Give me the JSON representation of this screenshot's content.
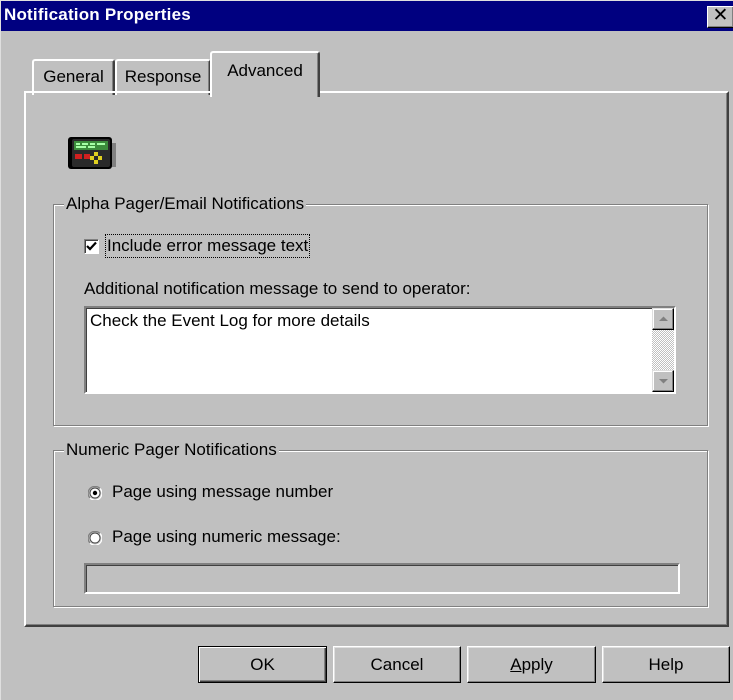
{
  "window": {
    "title": "Notification Properties",
    "close_glyph": "✕"
  },
  "tabs": [
    {
      "label": "General",
      "selected": false
    },
    {
      "label": "Response",
      "selected": false
    },
    {
      "label": "Advanced",
      "selected": true
    }
  ],
  "icon": {
    "name": "pager-icon"
  },
  "alpha_group": {
    "title": "Alpha Pager/Email Notifications",
    "include_error": {
      "label": "Include error message text",
      "checked": true
    },
    "additional_label": "Additional notification message to send to operator:",
    "message_value": "Check the Event Log for more details"
  },
  "numeric_group": {
    "title": "Numeric Pager Notifications",
    "options": [
      {
        "label": "Page using message number",
        "selected": true
      },
      {
        "label": "Page using numeric message:",
        "selected": false
      }
    ],
    "numeric_value": ""
  },
  "buttons": {
    "ok": "OK",
    "cancel": "Cancel",
    "apply_prefix": "A",
    "apply_rest": "pply",
    "help": "Help"
  }
}
